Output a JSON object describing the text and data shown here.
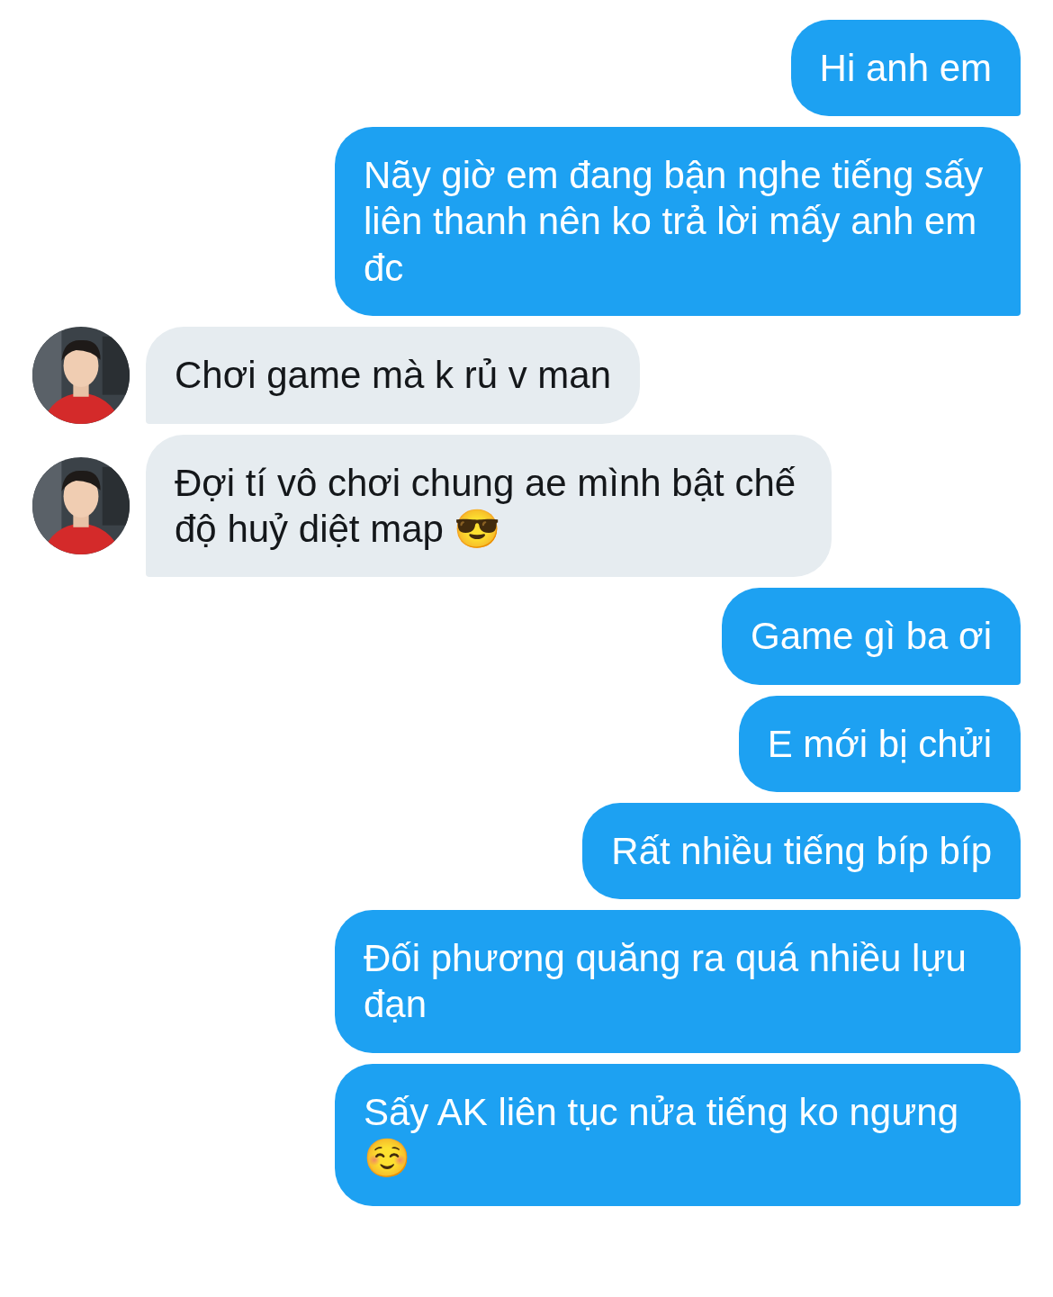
{
  "messages": [
    {
      "kind": "sent",
      "text": "Hi anh em"
    },
    {
      "kind": "sent",
      "text": "Nãy giờ em đang bận nghe tiếng sấy liên thanh nên ko trả lời mấy anh em đc"
    },
    {
      "kind": "received",
      "text": "Chơi game mà k rủ v man"
    },
    {
      "kind": "received",
      "text": "Đợi tí vô chơi chung ae mình bật chế độ huỷ diệt map 😎"
    },
    {
      "kind": "sent",
      "text": "Game gì ba ơi"
    },
    {
      "kind": "sent",
      "text": "E mới bị chửi"
    },
    {
      "kind": "sent",
      "text": "Rất nhiều tiếng bíp bíp"
    },
    {
      "kind": "sent",
      "text": "Đối phương quăng ra quá nhiều lựu đạn"
    },
    {
      "kind": "sent",
      "text": "Sấy AK liên tục nửa tiếng ko ngưng ☺️"
    }
  ]
}
